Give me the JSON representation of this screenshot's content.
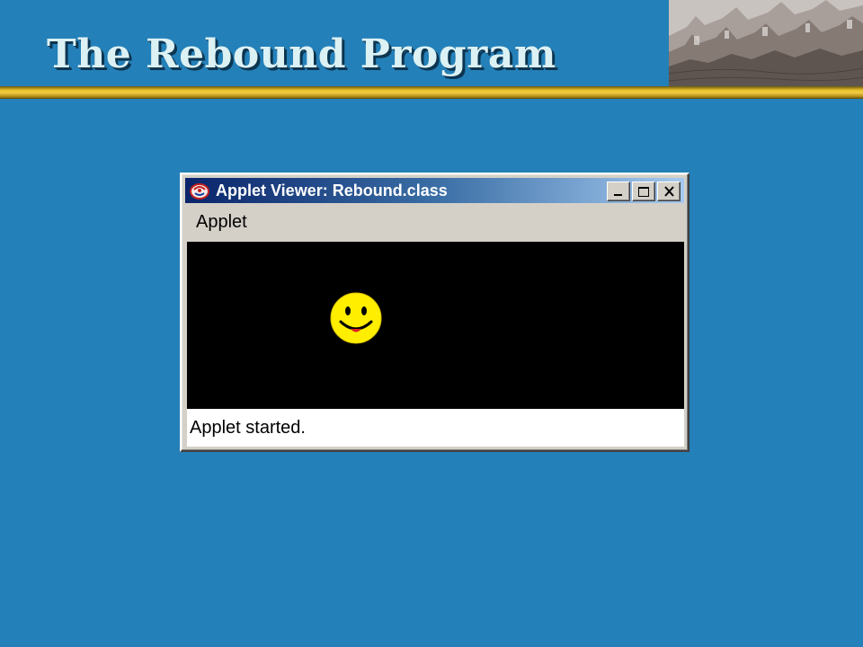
{
  "slide": {
    "title": "The Rebound Program"
  },
  "colors": {
    "background": "#2480b8",
    "title_text": "#dcf1f4",
    "gold_rule": "#e6bf2a",
    "titlebar_start": "#0a246a",
    "titlebar_end": "#a6caf0",
    "canvas": "#000000",
    "smiley_face": "#ffee00",
    "smiley_tongue": "#e02020"
  },
  "header_image": {
    "icon": "sand-castle-photo"
  },
  "applet_window": {
    "title": "Applet Viewer: Rebound.class",
    "icon": "java-applet-icon",
    "controls": {
      "minimize_icon": "minimize-icon",
      "maximize_icon": "maximize-icon",
      "close_icon": "close-icon"
    },
    "menu": {
      "items": [
        "Applet"
      ]
    },
    "canvas": {
      "sprite_icon": "smiley-face-icon"
    },
    "status": "Applet started."
  }
}
